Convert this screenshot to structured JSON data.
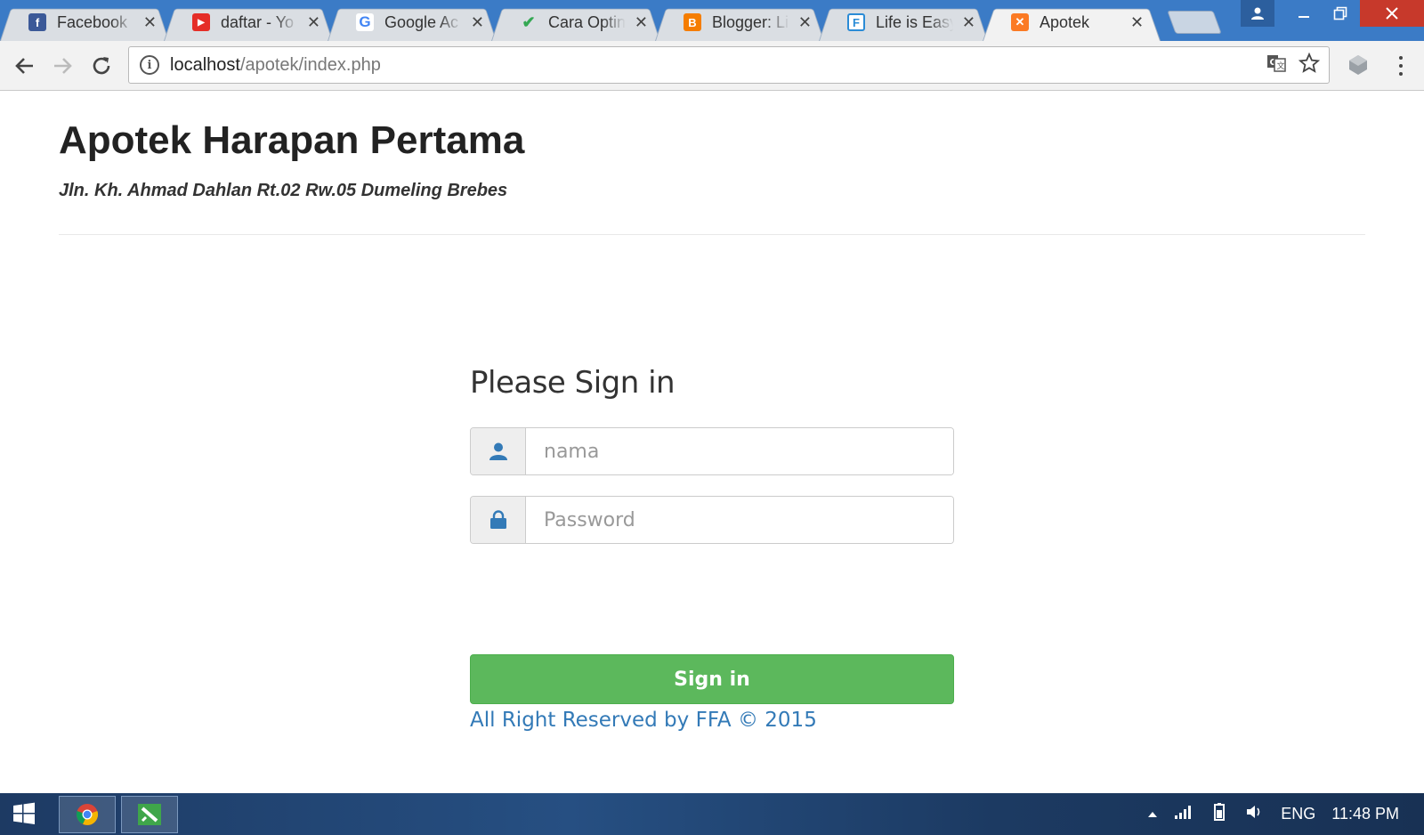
{
  "browser": {
    "tabs": [
      {
        "title": "Facebook",
        "favicon": "facebook-icon",
        "color": "#3b5998",
        "glyph": "f"
      },
      {
        "title": "daftar - Yo",
        "favicon": "youtube-icon",
        "color": "#e52d27",
        "glyph": "▶"
      },
      {
        "title": "Google Ac",
        "favicon": "google-icon",
        "color": "#ffffff",
        "glyph": "G"
      },
      {
        "title": "Cara Optin",
        "favicon": "checkmark-icon",
        "color": "#ffffff",
        "glyph": "✔"
      },
      {
        "title": "Blogger: Li",
        "favicon": "blogger-icon",
        "color": "#f57d00",
        "glyph": "B"
      },
      {
        "title": "Life is Easy",
        "favicon": "formsite-icon",
        "color": "#ffffff",
        "glyph": "F"
      },
      {
        "title": "Apotek",
        "favicon": "xampp-icon",
        "color": "#fb7a24",
        "glyph": "⊠",
        "active": true
      }
    ],
    "address": {
      "host": "localhost",
      "path": "/apotek/index.php"
    }
  },
  "page": {
    "title": "Apotek Harapan Pertama",
    "address": "Jln. Kh. Ahmad Dahlan Rt.02 Rw.05 Dumeling Brebes",
    "login": {
      "heading": "Please Sign in",
      "username_placeholder": "nama",
      "password_placeholder": "Password",
      "submit_label": "Sign in",
      "footer": "All Right Reserved by FFA © 2015"
    }
  },
  "taskbar": {
    "language": "ENG",
    "time": "11:48 PM"
  },
  "colors": {
    "primary_button": "#5cb85c",
    "link": "#337ab7",
    "browser_frame": "#3b7bc6"
  }
}
